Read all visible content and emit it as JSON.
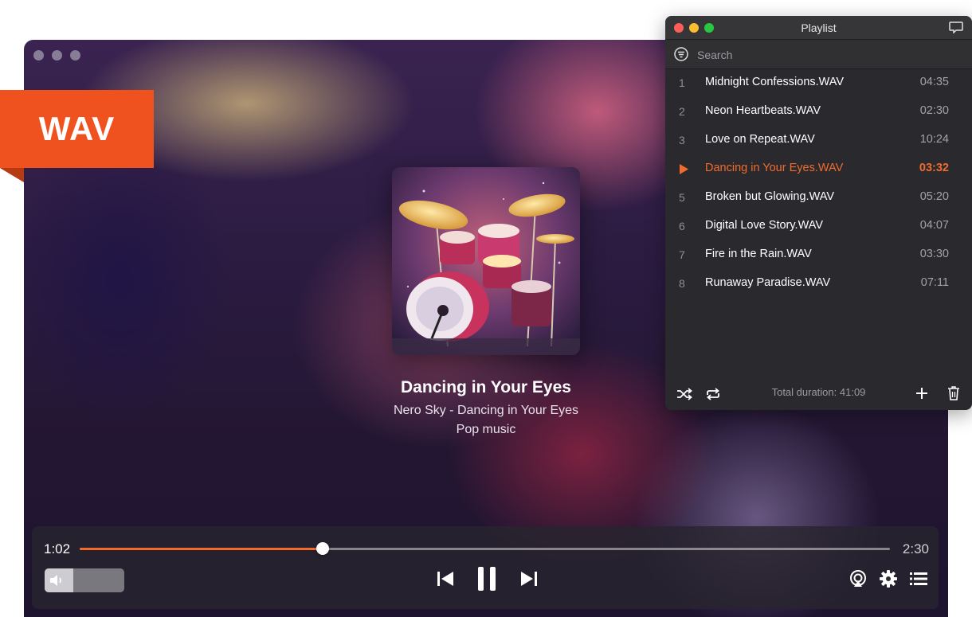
{
  "badge": {
    "label": "WAV",
    "color": "#f0521f"
  },
  "player": {
    "now_playing": {
      "title": "Dancing in Your Eyes",
      "subtitle": "Nero Sky - Dancing in Your Eyes",
      "genre": "Pop music"
    },
    "progress": {
      "current": "1:02",
      "total": "2:30",
      "fraction": 0.3
    },
    "volume": {
      "fraction": 0.36
    },
    "accent_color": "#f26b2d",
    "icons": {
      "volume": "speaker-icon",
      "previous": "skip-previous-icon",
      "pause": "pause-icon",
      "next": "skip-next-icon",
      "airplay": "airplay-icon",
      "settings": "gear-icon",
      "playlist": "list-icon"
    }
  },
  "playlist": {
    "title": "Playlist",
    "search_placeholder": "Search",
    "tracks": [
      {
        "num": "1",
        "name": "Midnight Confessions.WAV",
        "duration": "04:35",
        "active": false
      },
      {
        "num": "2",
        "name": "Neon Heartbeats.WAV",
        "duration": "02:30",
        "active": false
      },
      {
        "num": "3",
        "name": "Love on Repeat.WAV",
        "duration": "10:24",
        "active": false
      },
      {
        "num": "4",
        "name": "Dancing in Your Eyes.WAV",
        "duration": "03:32",
        "active": true
      },
      {
        "num": "5",
        "name": "Broken but Glowing.WAV",
        "duration": "05:20",
        "active": false
      },
      {
        "num": "6",
        "name": "Digital Love Story.WAV",
        "duration": "04:07",
        "active": false
      },
      {
        "num": "7",
        "name": "Fire in the Rain.WAV",
        "duration": "03:30",
        "active": false
      },
      {
        "num": "8",
        "name": "Runaway Paradise.WAV",
        "duration": "07:11",
        "active": false
      }
    ],
    "total_duration": "Total duration: 41:09",
    "traffic_colors": {
      "close": "#ff5f57",
      "minimize": "#febc2e",
      "zoom": "#28c840"
    }
  }
}
